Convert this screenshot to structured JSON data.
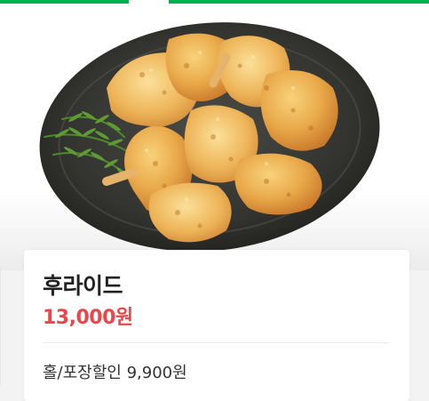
{
  "menu_item": {
    "name": "후라이드",
    "price": "13,000원",
    "discount_note": "홀/포장할인 9,900원"
  },
  "image": {
    "subject": "fried-chicken-photo"
  },
  "colors": {
    "accent_green": "#00b14f",
    "price_red": "#e8474b"
  }
}
